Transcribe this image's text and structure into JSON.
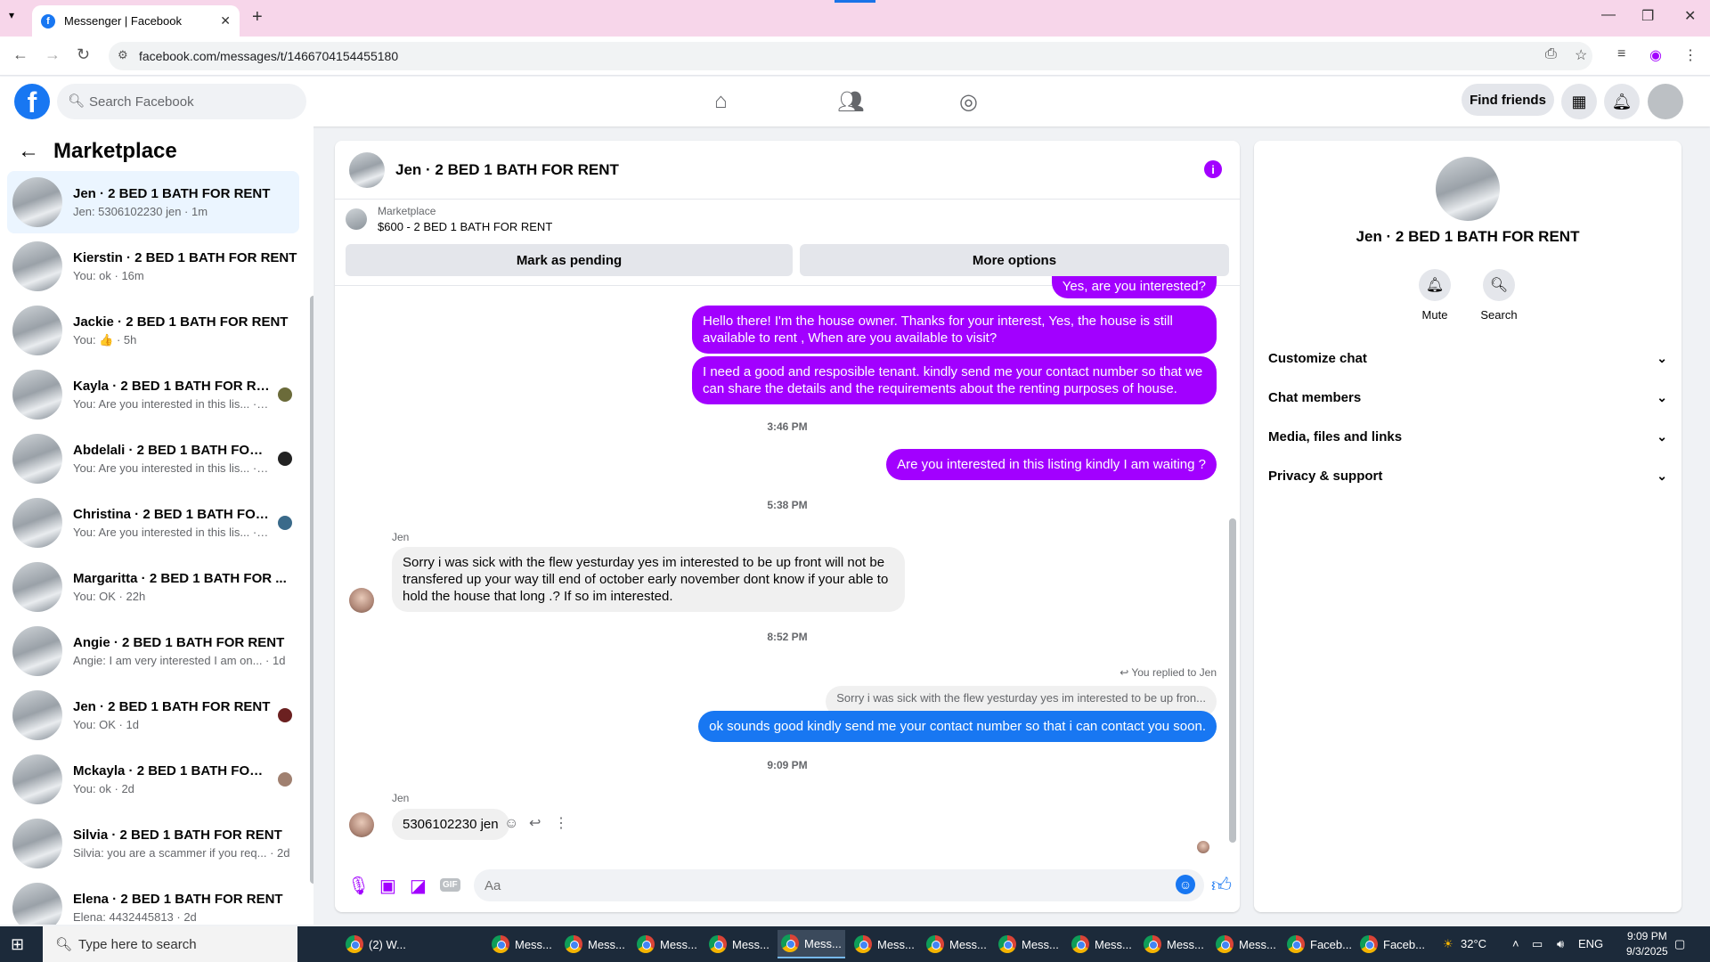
{
  "browser": {
    "tab_title": "Messenger | Facebook",
    "url": "facebook.com/messages/t/1466704154455180"
  },
  "fb_header": {
    "search_placeholder": "Search Facebook",
    "find_friends": "Find friends"
  },
  "sidebar": {
    "title": "Marketplace",
    "conversations": [
      {
        "name": "Jen · 2 BED 1 BATH FOR RENT",
        "snippet": "Jen: 5306102230 jen · 1m",
        "active": true
      },
      {
        "name": "Kierstin · 2 BED 1 BATH FOR RENT",
        "snippet": "You: ok · 16m"
      },
      {
        "name": "Jackie · 2 BED 1 BATH FOR RENT",
        "snippet": "You: 👍 · 5h"
      },
      {
        "name": "Kayla · 2 BED 1 BATH FOR RENT",
        "snippet": "You: Are you interested in this lis... · 5h"
      },
      {
        "name": "Abdelali · 2 BED 1 BATH FOR ...",
        "snippet": "You: Are you interested in this lis... · 5h"
      },
      {
        "name": "Christina · 2 BED 1 BATH FOR ...",
        "snippet": "You: Are you interested in this lis... · 5h"
      },
      {
        "name": "Margaritta · 2 BED 1 BATH FOR ...",
        "snippet": "You: OK · 22h"
      },
      {
        "name": "Angie · 2 BED 1 BATH FOR RENT",
        "snippet": "Angie: I am very interested I am on... · 1d"
      },
      {
        "name": "Jen · 2 BED 1 BATH FOR RENT",
        "snippet": "You: OK · 1d"
      },
      {
        "name": "Mckayla · 2 BED 1 BATH FOR ...",
        "snippet": "You: ok · 2d"
      },
      {
        "name": "Silvia · 2 BED 1 BATH FOR RENT",
        "snippet": "Silvia: you are a scammer if you req... · 2d"
      },
      {
        "name": "Elena · 2 BED 1 BATH FOR RENT",
        "snippet": "Elena: 4432445813 · 2d"
      }
    ]
  },
  "chat": {
    "title": "Jen · 2 BED 1 BATH FOR RENT",
    "listing_source": "Marketplace",
    "listing_price": "$600 - 2 BED 1 BATH FOR RENT",
    "mark_pending": "Mark as pending",
    "more_options": "More options",
    "messages": {
      "m0": "Yes, are you interested?",
      "m1": "Hello there! I'm the house owner. Thanks for your interest, Yes, the house is still available to rent , When are you available to visit?",
      "m2": "I need a good and resposible tenant.  kindly send me your contact number so that we can share the details and the requirements about the renting purposes of house.",
      "ts1": "3:46 PM",
      "m3": "Are you interested in this listing kindly I am waiting ?",
      "ts2": "5:38 PM",
      "sender1": "Jen",
      "m4": "Sorry i was sick with the flew yesturday yes im interested to be up front will not be transfered up your way till end of october early november dont know if your able to hold the house that long .? If so im interested.",
      "ts3": "8:52 PM",
      "replied_label": "You replied to Jen",
      "quoted": "Sorry i was sick with the flew yesturday yes im interested to be up fron...",
      "m5": "ok sounds good kindly  send me your contact number so that i can contact you soon.",
      "ts4": "9:09 PM",
      "sender2": "Jen",
      "m6": "5306102230 jen"
    },
    "composer_placeholder": "Aa",
    "composer_gif": "GIF"
  },
  "info_panel": {
    "title": "Jen · 2 BED 1 BATH FOR RENT",
    "mute": "Mute",
    "search": "Search",
    "rows": [
      "Customize chat",
      "Chat members",
      "Media, files and links",
      "Privacy & support"
    ]
  },
  "taskbar": {
    "search_placeholder": "Type here to search",
    "apps": [
      "(2) W...",
      "Mess...",
      "Mess...",
      "Mess...",
      "Mess...",
      "Mess...",
      "Mess...",
      "Mess...",
      "Mess...",
      "Mess...",
      "Mess...",
      "Mess...",
      "Faceb...",
      "Faceb..."
    ],
    "weather": "32°C",
    "lang": "ENG",
    "time": "9:09 PM",
    "date": "9/3/2025"
  },
  "colors": {
    "accent_purple": "#a200ff",
    "fb_blue": "#1877f2"
  }
}
